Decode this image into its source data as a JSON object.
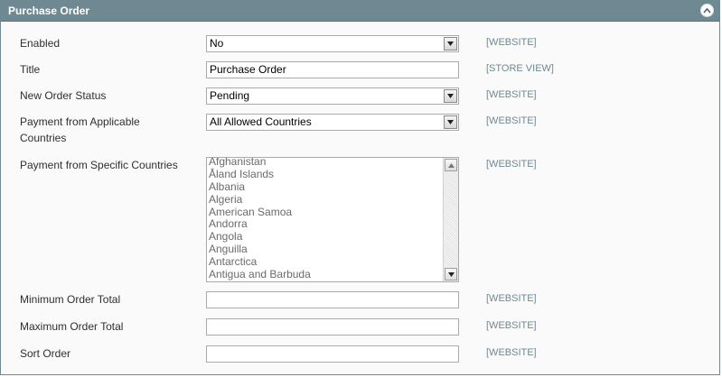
{
  "panel": {
    "title": "Purchase Order"
  },
  "fields": {
    "enabled": {
      "label": "Enabled",
      "value": "No",
      "scope": "[WEBSITE]"
    },
    "title": {
      "label": "Title",
      "value": "Purchase Order",
      "scope": "[STORE VIEW]"
    },
    "new_order_status": {
      "label": "New Order Status",
      "value": "Pending",
      "scope": "[WEBSITE]"
    },
    "applicable_countries": {
      "label_line1": "Payment from Applicable",
      "label_line2": "Countries",
      "value": "All Allowed Countries",
      "scope": "[WEBSITE]"
    },
    "specific_countries": {
      "label": "Payment from Specific Countries",
      "scope": "[WEBSITE]",
      "options": [
        "Afghanistan",
        "Åland Islands",
        "Albania",
        "Algeria",
        "American Samoa",
        "Andorra",
        "Angola",
        "Anguilla",
        "Antarctica",
        "Antigua and Barbuda"
      ]
    },
    "min_order_total": {
      "label": "Minimum Order Total",
      "value": "",
      "scope": "[WEBSITE]"
    },
    "max_order_total": {
      "label": "Maximum Order Total",
      "value": "",
      "scope": "[WEBSITE]"
    },
    "sort_order": {
      "label": "Sort Order",
      "value": "",
      "scope": "[WEBSITE]"
    }
  },
  "icons": {
    "collapse": "chevron-up-icon",
    "select_arrow": "triangle-down-icon",
    "scroll_up": "triangle-up-icon",
    "scroll_down": "triangle-down-icon"
  },
  "colors": {
    "header_bg": "#6f8992",
    "scope_text": "#6f8992",
    "panel_bg": "#fafafa"
  }
}
